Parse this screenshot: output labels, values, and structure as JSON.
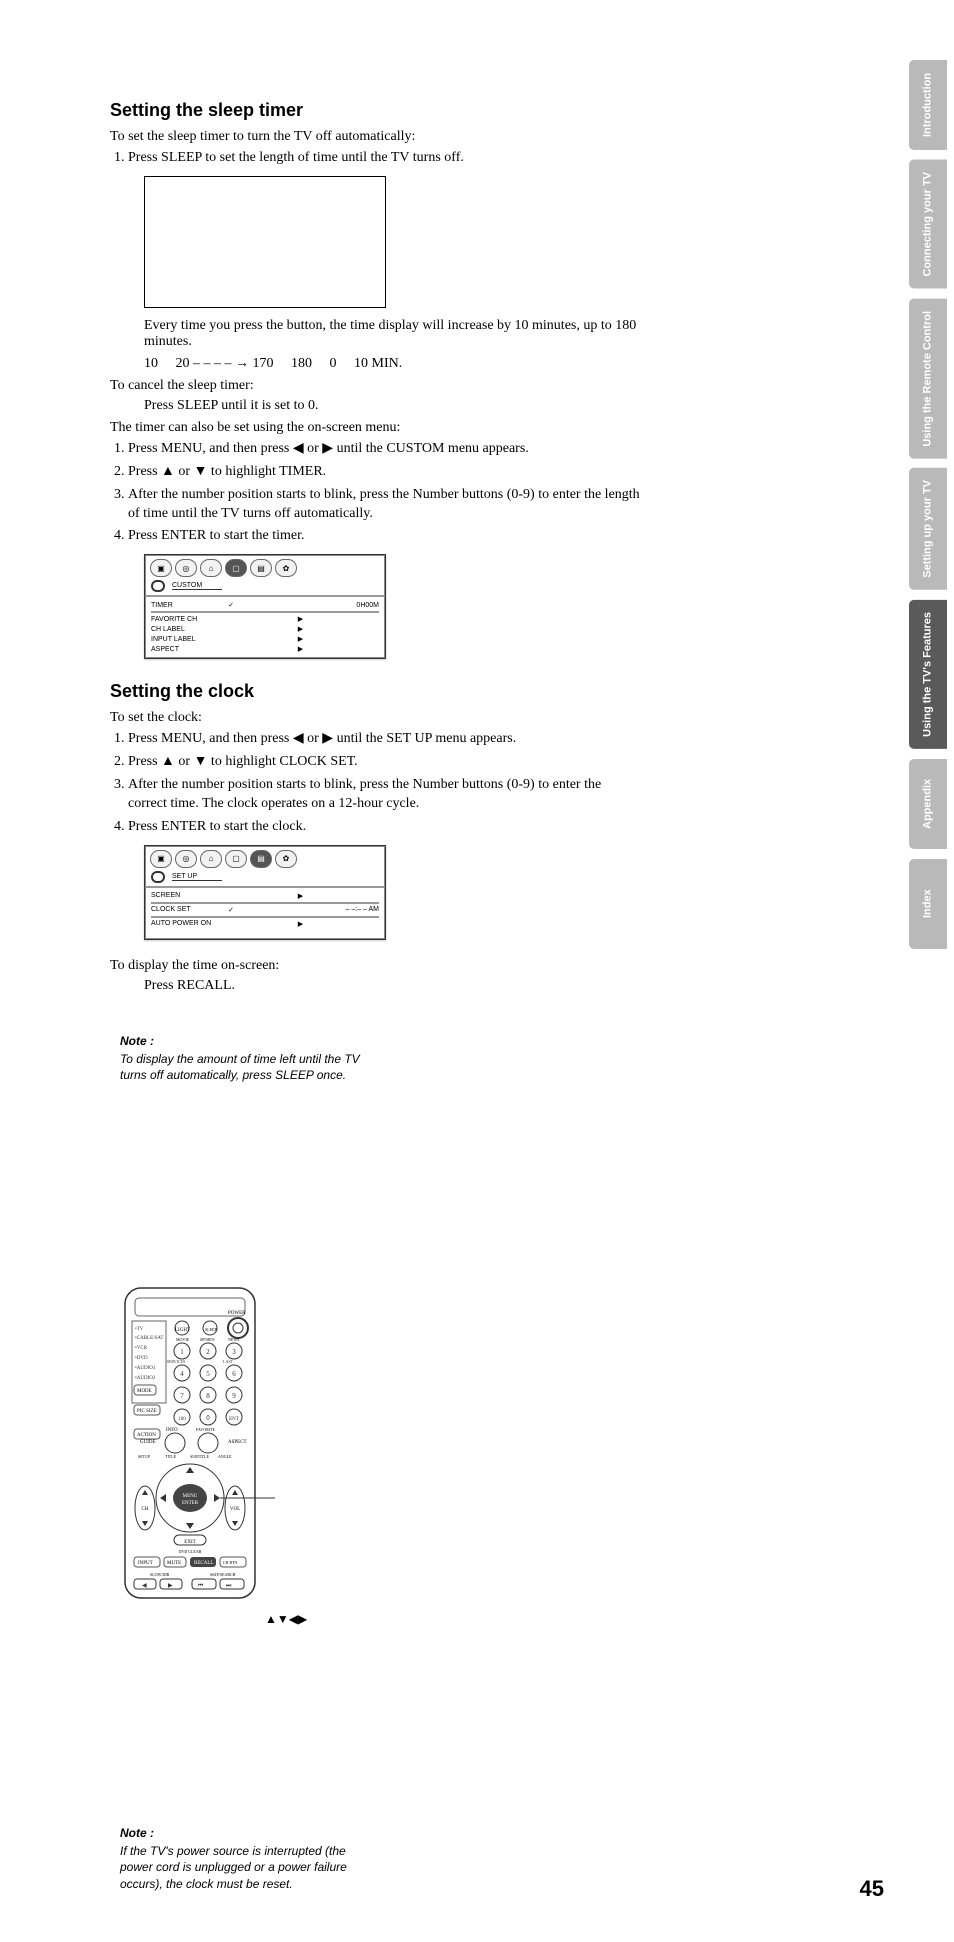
{
  "page_number": "45",
  "side_tabs": [
    {
      "label": "Introduction",
      "active": false
    },
    {
      "label": "Connecting your TV",
      "active": false
    },
    {
      "label": "Using the Remote Control",
      "active": false
    },
    {
      "label": "Setting up your TV",
      "active": false
    },
    {
      "label": "Using the TV's Features",
      "active": true
    },
    {
      "label": "Appendix",
      "active": false
    },
    {
      "label": "Index",
      "active": false
    }
  ],
  "section1": {
    "title": "Setting the sleep timer",
    "intro": "To set the sleep timer to turn the TV off automatically:",
    "step1": "Press SLEEP to set the length of time until the TV turns off.",
    "after_box": "Every time you press the button, the time display will increase by 10 minutes, up to 180 minutes.",
    "sequence": "10     20 – – – – → 170     180     0     10 MIN.",
    "cancel_lead": "To cancel the sleep timer:",
    "cancel_step": "Press SLEEP until it is set to 0.",
    "onscreen_lead": "The timer can also be set using the on-screen menu:",
    "os_steps": [
      "Press MENU, and then press ◀ or ▶ until the CUSTOM menu appears.",
      "Press ▲ or ▼ to highlight TIMER.",
      "After the number position starts to blink, press the Number buttons (0-9) to enter the length of time until the TV turns off automatically.",
      "Press ENTER to start the timer."
    ],
    "osd": {
      "category": "CUSTOM",
      "rows": [
        {
          "l": "TIMER",
          "check": "✓",
          "val": "0H00M"
        },
        {
          "l": "FAVORITE CH",
          "arrows": "▶"
        },
        {
          "l": "CH LABEL",
          "arrows": "▶"
        },
        {
          "l": "INPUT LABEL",
          "arrows": "▶"
        },
        {
          "l": "ASPECT",
          "arrows": "▶"
        }
      ]
    }
  },
  "note1": {
    "title": "Note :",
    "body": "To display the amount of time left until the TV turns off automatically, press SLEEP once."
  },
  "arrows_label": "▲▼◀▶",
  "section2": {
    "title": "Setting the clock",
    "intro": "To set the clock:",
    "steps": [
      "Press MENU, and then press ◀ or ▶ until the SET UP menu appears.",
      "Press ▲ or ▼ to highlight CLOCK SET.",
      "After the number position starts to blink, press the Number buttons (0-9) to enter the correct time. The clock operates on a 12-hour cycle.",
      "Press ENTER to start the clock."
    ],
    "osd": {
      "category": "SET UP",
      "rows": [
        {
          "l": "SCREEN",
          "arrows": "▶"
        },
        {
          "l": "CLOCK SET",
          "check": "✓",
          "val": "– –:– – AM"
        },
        {
          "l": "AUTO POWER ON",
          "arrows": "▶"
        }
      ]
    },
    "display_lead": "To display the time on-screen:",
    "display_step": "Press RECALL."
  },
  "note2": {
    "title": "Note :",
    "body": "If the TV's power source is interrupted (the power cord is unplugged or a power failure occurs), the clock must be reset."
  }
}
